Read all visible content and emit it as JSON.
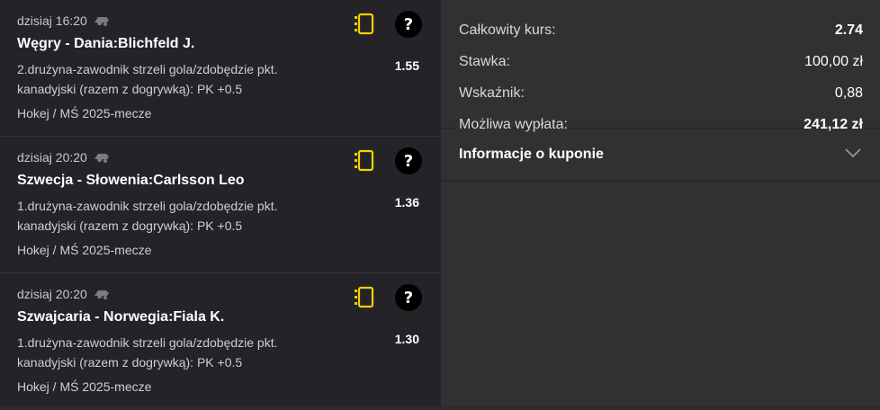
{
  "bets": [
    {
      "time": "dzisiaj 16:20",
      "match": "Węgry - Dania:Blichfeld J.",
      "market_line1": "2.drużyna-zawodnik strzeli gola/zdobędzie pkt.",
      "market_line2": "kanadyjski (razem z dogrywką): PK +0.5",
      "odds": "1.55",
      "league": "Hokej / MŚ 2025-mecze",
      "help_label": "?"
    },
    {
      "time": "dzisiaj 20:20",
      "match": "Szwecja - Słowenia:Carlsson Leo",
      "market_line1": "1.drużyna-zawodnik strzeli gola/zdobędzie pkt.",
      "market_line2": "kanadyjski (razem z dogrywką): PK +0.5",
      "odds": "1.36",
      "league": "Hokej / MŚ 2025-mecze",
      "help_label": "?"
    },
    {
      "time": "dzisiaj 20:20",
      "match": "Szwajcaria - Norwegia:Fiala K.",
      "market_line1": "1.drużyna-zawodnik strzeli gola/zdobędzie pkt.",
      "market_line2": "kanadyjski (razem z dogrywką): PK +0.5",
      "odds": "1.30",
      "league": "Hokej / MŚ 2025-mecze",
      "help_label": "?"
    }
  ],
  "summary": {
    "total_odds_label": "Całkowity kurs:",
    "total_odds_value": "2.74",
    "stake_label": "Stawka:",
    "stake_value": "100,00 zł",
    "ratio_label": "Wskaźnik:",
    "ratio_value": "0,88",
    "payout_label": "Możliwa wypłata:",
    "payout_value": "241,12 zł"
  },
  "info": {
    "label": "Informacje o kuponie"
  },
  "colors": {
    "accent_yellow": "#f5d000",
    "panel_left": "#232328",
    "panel_right": "#313134"
  },
  "icons": {
    "sport": "hockey-icon",
    "note": "note-icon",
    "help": "help-icon",
    "expand": "chevron-down-icon"
  }
}
